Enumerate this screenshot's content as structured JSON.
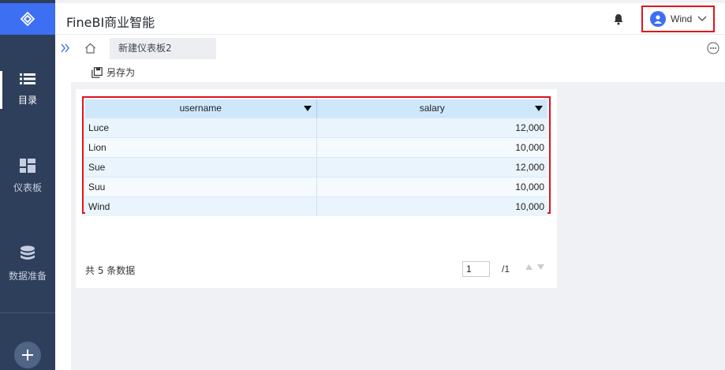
{
  "header": {
    "title": "FineBI商业智能",
    "user_name": "Wind"
  },
  "sidebar": {
    "items": [
      {
        "label": "目录",
        "icon": "list-icon",
        "active": true
      },
      {
        "label": "仪表板",
        "icon": "dashboard-icon",
        "active": false
      },
      {
        "label": "数据准备",
        "icon": "database-icon",
        "active": false
      }
    ]
  },
  "tabs": [
    {
      "label": "新建仪表板2"
    }
  ],
  "toolbar": {
    "save_as_label": "另存为"
  },
  "table": {
    "columns": [
      "username",
      "salary"
    ],
    "rows": [
      [
        "Luce",
        "12,000"
      ],
      [
        "Lion",
        "10,000"
      ],
      [
        "Sue",
        "12,000"
      ],
      [
        "Suu",
        "10,000"
      ],
      [
        "Wind",
        "10,000"
      ]
    ]
  },
  "pagination": {
    "count_label": "共 5 条数据",
    "current_page": "1",
    "total_pages": "/1"
  },
  "colors": {
    "sidebar_bg": "#2e3f5c",
    "accent": "#3d6ff2",
    "highlight_border": "#e3121a",
    "table_header_bg": "#cfe7fb"
  }
}
